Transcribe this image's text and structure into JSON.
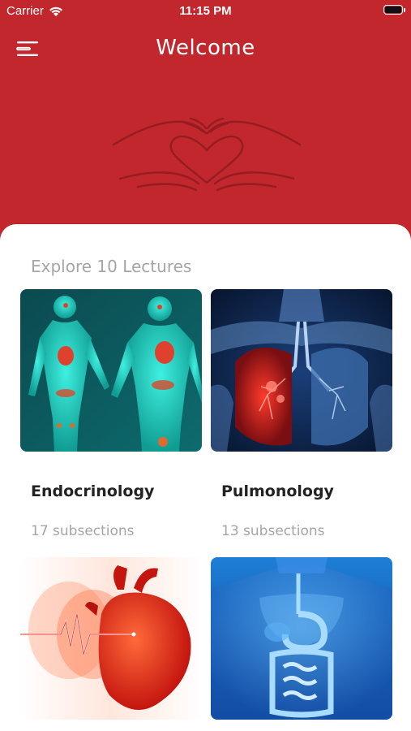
{
  "status_bar": {
    "carrier": "Carrier",
    "time": "11:15 PM"
  },
  "nav": {
    "title": "Welcome"
  },
  "colors": {
    "primary": "#c1272d",
    "sheet": "#ffffff",
    "muted_text": "#a5a5a5"
  },
  "explore": {
    "heading": "Explore 10 Lectures"
  },
  "lectures": [
    {
      "title": "Endocrinology",
      "subsections": "17 subsections",
      "image": "endocrine-body-illustration"
    },
    {
      "title": "Pulmonology",
      "subsections": "13 subsections",
      "image": "lungs-illustration"
    },
    {
      "title": "",
      "subsections": "",
      "image": "heart-ecg-illustration"
    },
    {
      "title": "",
      "subsections": "",
      "image": "digestive-system-illustration"
    }
  ]
}
